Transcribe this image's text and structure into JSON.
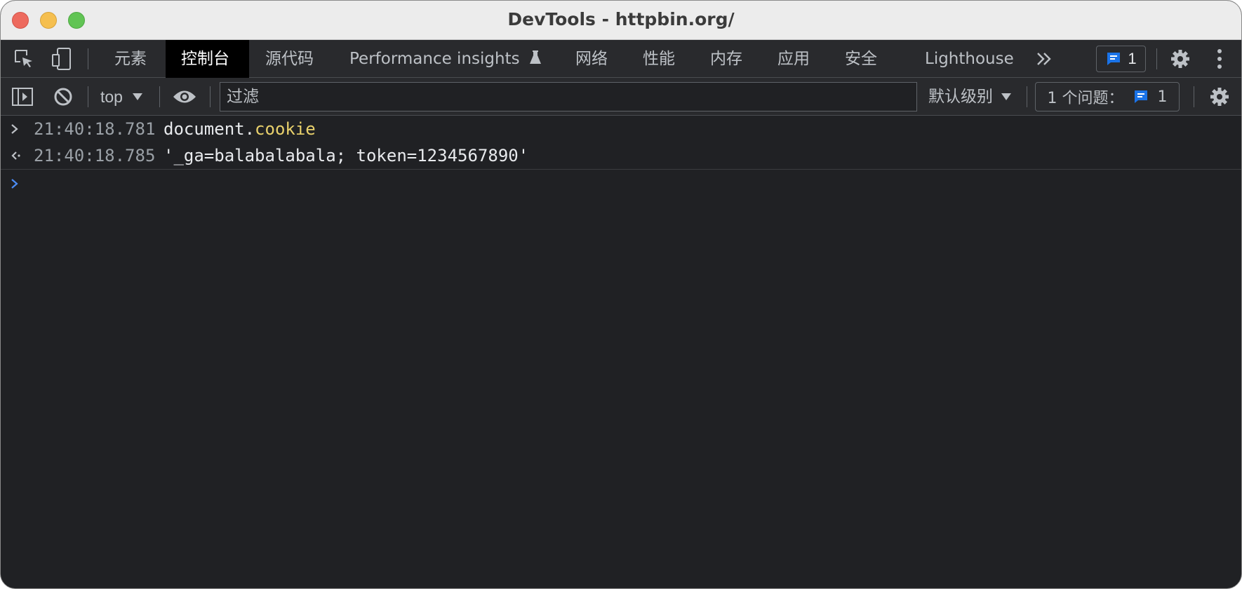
{
  "window": {
    "title": "DevTools - httpbin.org/"
  },
  "tabs": [
    {
      "label": "元素"
    },
    {
      "label": "控制台",
      "active": true
    },
    {
      "label": "源代码"
    },
    {
      "label": "Performance insights"
    },
    {
      "label": "网络"
    },
    {
      "label": "性能"
    },
    {
      "label": "内存"
    },
    {
      "label": "应用"
    },
    {
      "label": "安全"
    },
    {
      "label": "Lighthouse"
    }
  ],
  "header": {
    "issues_count": "1"
  },
  "toolbar": {
    "context": "top",
    "filter_placeholder": "过滤",
    "levels_label": "默认级别",
    "issues_label": "1 个问题：",
    "issues_count": "1"
  },
  "console": {
    "entries": [
      {
        "kind": "input",
        "timestamp": "21:40:18.781",
        "object": "document.",
        "property": "cookie"
      },
      {
        "kind": "output",
        "timestamp": "21:40:18.785",
        "value": "'_ga=balabalabala; token=1234567890'"
      }
    ]
  },
  "colors": {
    "background": "#202124",
    "toolbar": "#292a2d",
    "accent_blue": "#1a73e8",
    "string": "#5cd5c5",
    "property": "#e9d16c"
  },
  "icons": [
    "inspect-element-icon",
    "device-toolbar-icon",
    "flask-icon",
    "more-tabs-icon",
    "chat-icon",
    "gear-icon",
    "kebab-menu-icon",
    "sidebar-toggle-icon",
    "clear-console-icon",
    "dropdown-arrow-icon",
    "eye-icon",
    "prompt-chevron-icon",
    "result-arrow-icon"
  ]
}
